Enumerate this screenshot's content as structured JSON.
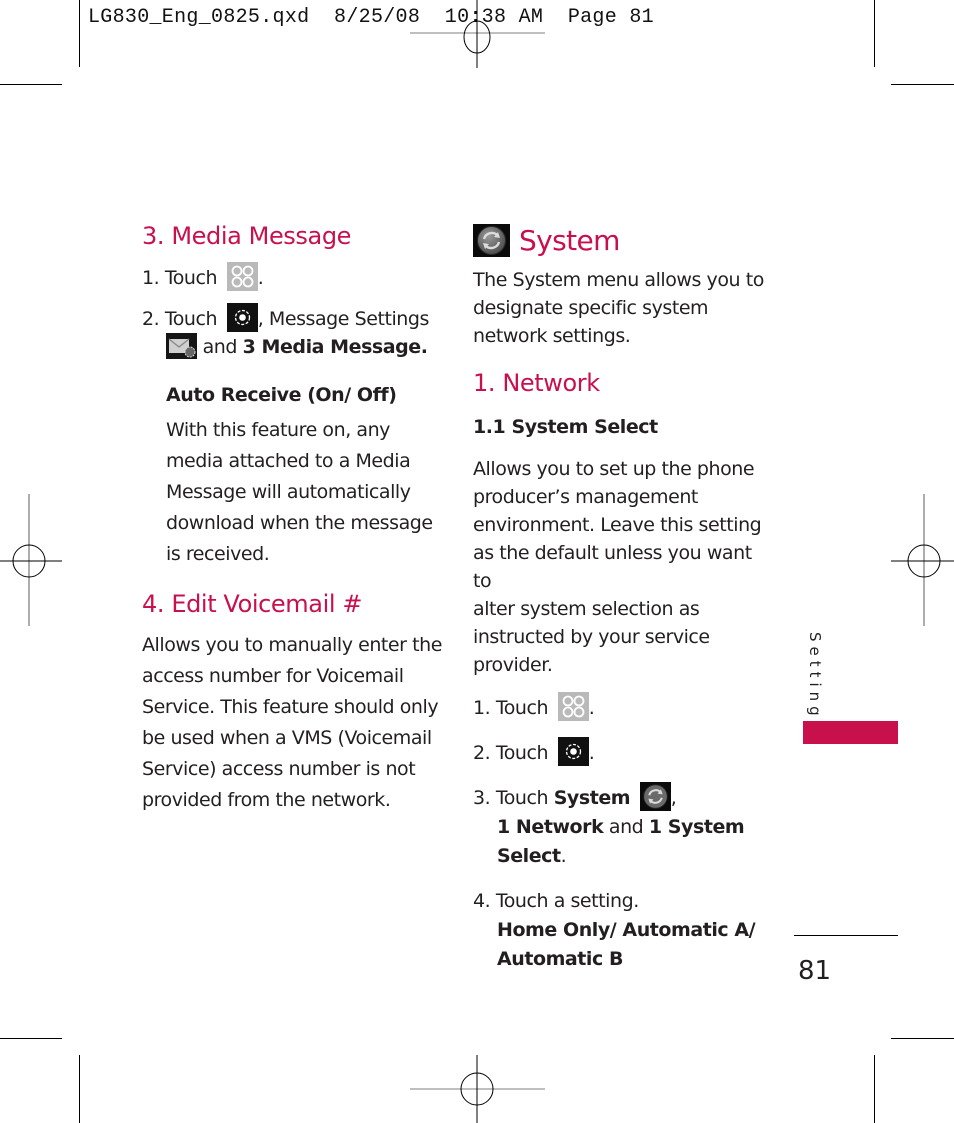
{
  "slug": {
    "filename": "LG830_Eng_0825.qxd",
    "date": "8/25/08",
    "time": "10:38 AM",
    "page_label": "Page 81"
  },
  "left": {
    "media_message": {
      "heading": "3. Media Message",
      "step1_prefix": "1. Touch",
      "step1_icon": "menu-grid-icon",
      "step1_suffix": ".",
      "step2_prefix": "2. Touch",
      "step2_icon": "settings-gear-icon",
      "step2_middle": ", Message Settings",
      "step2_icon2": "message-settings-icon",
      "step2_and": "and",
      "step2_bold": "3 Media Message.",
      "sub_heading": "Auto Receive (On/ Off)",
      "description_lines": [
        "With this feature on, any",
        "media attached to a Media",
        "Message will automatically",
        "download when the message",
        "is received."
      ]
    },
    "edit_voicemail": {
      "heading": "4. Edit Voicemail #",
      "description_lines": [
        "Allows you to manually enter the",
        "access number for Voicemail",
        "Service. This feature should only",
        "be used when a VMS (Voicemail",
        "Service) access number is not",
        "provided from the network."
      ]
    }
  },
  "right": {
    "system": {
      "icon": "system-refresh-icon",
      "heading": "System",
      "intro_lines": [
        "The System menu allows you to",
        "designate specific system",
        "network settings."
      ]
    },
    "network": {
      "heading": "1. Network",
      "sub_heading": "1.1 System Select",
      "description_lines": [
        "Allows you to set up the phone",
        "producer’s management",
        "environment. Leave this setting",
        "as the default unless you want to",
        "alter system selection as",
        "instructed by your service",
        "provider."
      ],
      "step1_prefix": "1. Touch",
      "step1_suffix": ".",
      "step2_prefix": "2. Touch",
      "step2_suffix": ".",
      "step3_prefix": "3. Touch",
      "step3_bold1": "System",
      "step3_comma": ",",
      "step3_bold2": "1 Network",
      "step3_and": "and",
      "step3_bold3": "1 System",
      "step3_bold4": "Select",
      "step3_period": ".",
      "step4_text": "4. Touch a setting.",
      "step4_options_line1": "Home Only/ Automatic A/",
      "step4_options_line2": "Automatic B"
    }
  },
  "side_tab": {
    "label": "Settings",
    "color": "#c8104c"
  },
  "footer": {
    "page_number": "81"
  },
  "colors": {
    "heading_red": "#c8104c",
    "text": "#231f20"
  }
}
